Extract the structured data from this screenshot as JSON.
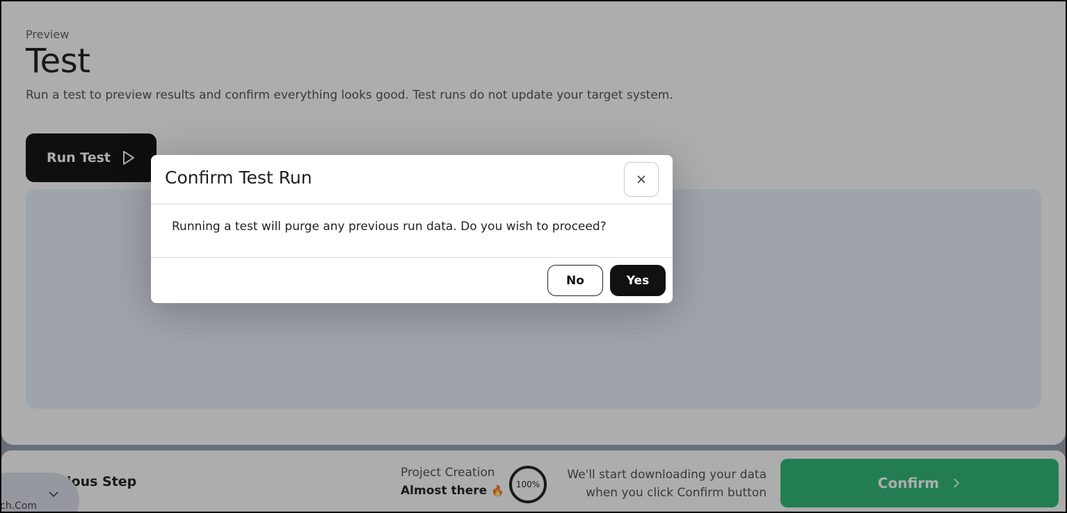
{
  "page": {
    "eyebrow": "Preview",
    "title": "Test",
    "subtitle": "Run a test to preview results and confirm everything looks good. Test runs do not update your target system.",
    "run_button": "Run Test"
  },
  "footer": {
    "previous_step": "ious Step",
    "tab_domain": "ch.Com",
    "project_label": "Project Creation",
    "project_status": "Almost there",
    "progress": "100%",
    "download_note_line1": "We'll start downloading your data",
    "download_note_line2": "when you click Confirm button",
    "confirm_button": "Confirm"
  },
  "modal": {
    "title": "Confirm Test Run",
    "message": "Running a test will purge any previous run data. Do you wish to proceed?",
    "no_button": "No",
    "yes_button": "Yes"
  },
  "colors": {
    "confirm_green": "#1fb46c",
    "primary_black": "#111111",
    "preview_area": "#e8effa"
  },
  "icons": {
    "run": "play-icon",
    "close": "close-icon",
    "confirm": "chevron-right-icon",
    "tab": "chevron-down-icon",
    "status": "flame-icon"
  }
}
